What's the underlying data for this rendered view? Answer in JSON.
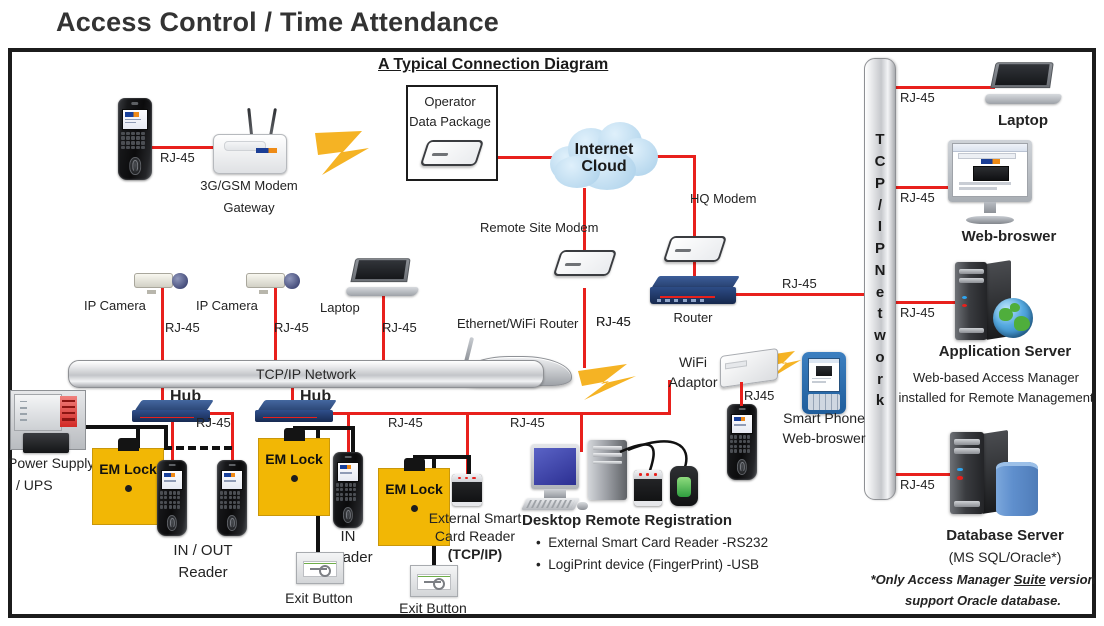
{
  "page": {
    "title": "Access Control / Time Attendance",
    "diagram_title": "A Typical Connection Diagram",
    "accent_wire_color": "#e8201c",
    "emlock_color": "#f2b705",
    "bolt_color": "#f5b324"
  },
  "labels": {
    "rj45": "RJ-45",
    "rj45_no_dash": "RJ45",
    "gsm_modem": "3G/GSM Modem",
    "gateway": "Gateway",
    "operator": "Operator",
    "data_package": "Data Package",
    "internet": "Internet",
    "cloud": "Cloud",
    "remote_site_modem": "Remote Site Modem",
    "hq_modem": "HQ Modem",
    "router": "Router",
    "ip_camera": "IP Camera",
    "laptop": "Laptop",
    "ethernet_wifi_router": "Ethernet/WiFi Router",
    "tcpip_network_h": "TCP/IP Network",
    "tcpip_network_v": "T C P / I P  N e t w o r k",
    "hub": "Hub",
    "power_supply": "Power Supply",
    "ups": "/ UPS",
    "em_lock": "EM Lock",
    "in_out_reader_1": "IN  /  OUT",
    "in_out_reader_2": "Reader",
    "in_reader_1": "IN",
    "in_reader_2": "Reader",
    "exit_button": "Exit Button",
    "external_smart_1": "External Smart",
    "external_smart_2": "Card Reader",
    "external_smart_3": "(TCP/IP)",
    "wifi_adaptor_1": "WiFi",
    "wifi_adaptor_2": "Adaptor",
    "smart_phone_1": "Smart Phone",
    "smart_phone_2": "Web-broswer",
    "desktop_remote_registration": "Desktop Remote Registration",
    "bullet_1": "External Smart Card Reader -RS232",
    "bullet_2": "LogiPrint device (FingerPrint) -USB",
    "web_browser": "Web-broswer",
    "application_server": "Application Server",
    "app_note_1": "Web-based Access Manager",
    "app_note_2": "installed for Remote Management",
    "database_server": "Database Server",
    "db_note": "(MS SQL/Oracle*)",
    "footnote_1a": "*Only Access Manager ",
    "footnote_1b": "Suite",
    "footnote_1c": " version",
    "footnote_2": "support Oracle database."
  },
  "tcpip_vertical_letters": [
    "T",
    "C",
    "P",
    "/",
    "I",
    "P",
    "N",
    "e",
    "t",
    "w",
    "o",
    "r",
    "k"
  ]
}
